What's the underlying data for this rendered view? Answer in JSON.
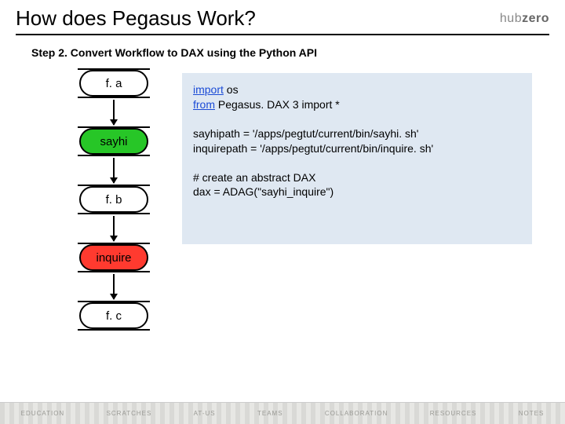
{
  "title": "How does Pegasus Work?",
  "logo": {
    "left": "hub",
    "right": "zero"
  },
  "subtitle": "Step 2. Convert Workflow to DAX using the Python API",
  "diagram": {
    "nodes": [
      "f. a",
      "sayhi",
      "f. b",
      "inquire",
      "f. c"
    ]
  },
  "code": {
    "l1a": "import",
    "l1b": " os",
    "l2a": "from",
    "l2b": " Pegasus. DAX 3 import *",
    "l3": "sayhipath = '/apps/pegtut/current/bin/sayhi. sh'",
    "l4": "inquirepath = '/apps/pegtut/current/bin/inquire. sh'",
    "l5": "# create an abstract DAX",
    "l6": "dax = ADAG(\"sayhi_inquire\")"
  },
  "footer": [
    "EDUCATION",
    "SCRATCHES",
    "AT-US",
    "TEAMS",
    "COLLABORATION",
    "resources",
    "notes"
  ]
}
